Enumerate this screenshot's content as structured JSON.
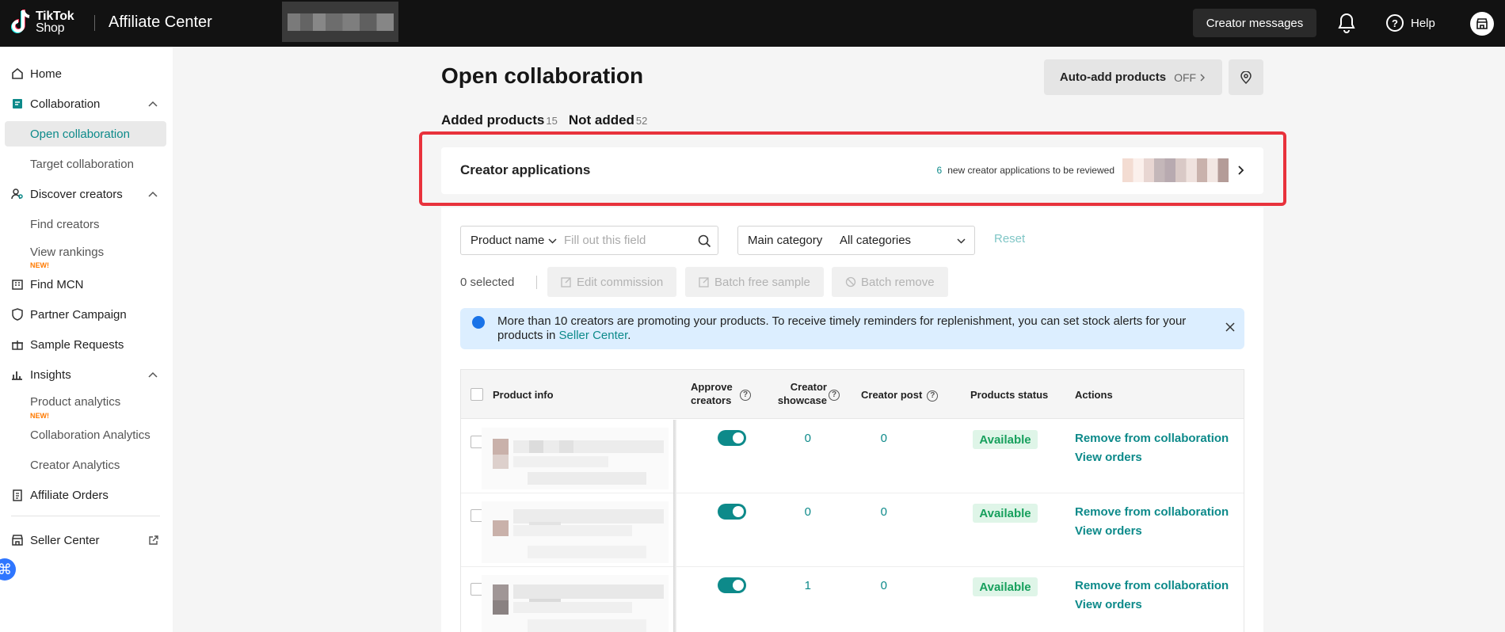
{
  "topbar": {
    "logo_line1": "TikTok",
    "logo_line2": "Shop",
    "app_title": "Affiliate Center",
    "creator_messages": "Creator messages",
    "help": "Help"
  },
  "sidebar": {
    "home": "Home",
    "collaboration": "Collaboration",
    "open_collaboration": "Open collaboration",
    "target_collaboration": "Target collaboration",
    "discover_creators": "Discover creators",
    "find_creators": "Find creators",
    "view_rankings": "View rankings",
    "new_tag": "NEW!",
    "find_mcn": "Find MCN",
    "partner_campaign": "Partner Campaign",
    "sample_requests": "Sample Requests",
    "insights": "Insights",
    "product_analytics": "Product analytics",
    "collaboration_analytics": "Collaboration Analytics",
    "creator_analytics": "Creator Analytics",
    "affiliate_orders": "Affiliate Orders",
    "seller_center": "Seller Center"
  },
  "main": {
    "title": "Open collaboration",
    "auto_add_label": "Auto-add products",
    "auto_add_state": "OFF",
    "tabs": [
      {
        "label": "Added products",
        "count": "15"
      },
      {
        "label": "Not added",
        "count": "52"
      }
    ],
    "creator_apps": {
      "title": "Creator applications",
      "count": "6",
      "text": "new creator applications to be reviewed"
    },
    "filter": {
      "field_label": "Product name",
      "placeholder": "Fill out this field",
      "category_label": "Main category",
      "category_value": "All categories",
      "reset": "Reset"
    },
    "bulk": {
      "selected": "0 selected",
      "edit_commission": "Edit commission",
      "batch_free_sample": "Batch free sample",
      "batch_remove": "Batch remove"
    },
    "alert": {
      "text": "More than 10 creators are promoting your products. To receive timely reminders for replenishment, you can set stock alerts for your products in ",
      "link": "Seller Center",
      "suffix": "."
    },
    "table": {
      "headers": {
        "product_info": "Product info",
        "approve_l1": "Approve",
        "approve_l2": "creators",
        "showcase_l1": "Creator",
        "showcase_l2": "showcase",
        "creator_post": "Creator post",
        "status": "Products status",
        "actions": "Actions"
      },
      "rows": [
        {
          "showcase": "0",
          "post": "0",
          "status": "Available",
          "action1": "Remove from collaboration",
          "action2": "View orders"
        },
        {
          "showcase": "0",
          "post": "0",
          "status": "Available",
          "action1": "Remove from collaboration",
          "action2": "View orders"
        },
        {
          "showcase": "1",
          "post": "0",
          "status": "Available",
          "action1": "Remove from collaboration",
          "action2": "View orders"
        }
      ]
    }
  },
  "colors": {
    "accent": "#0d8a8a",
    "topbar": "#121212",
    "highlight_frame": "#e8323c",
    "status_green": "#17a05d"
  }
}
